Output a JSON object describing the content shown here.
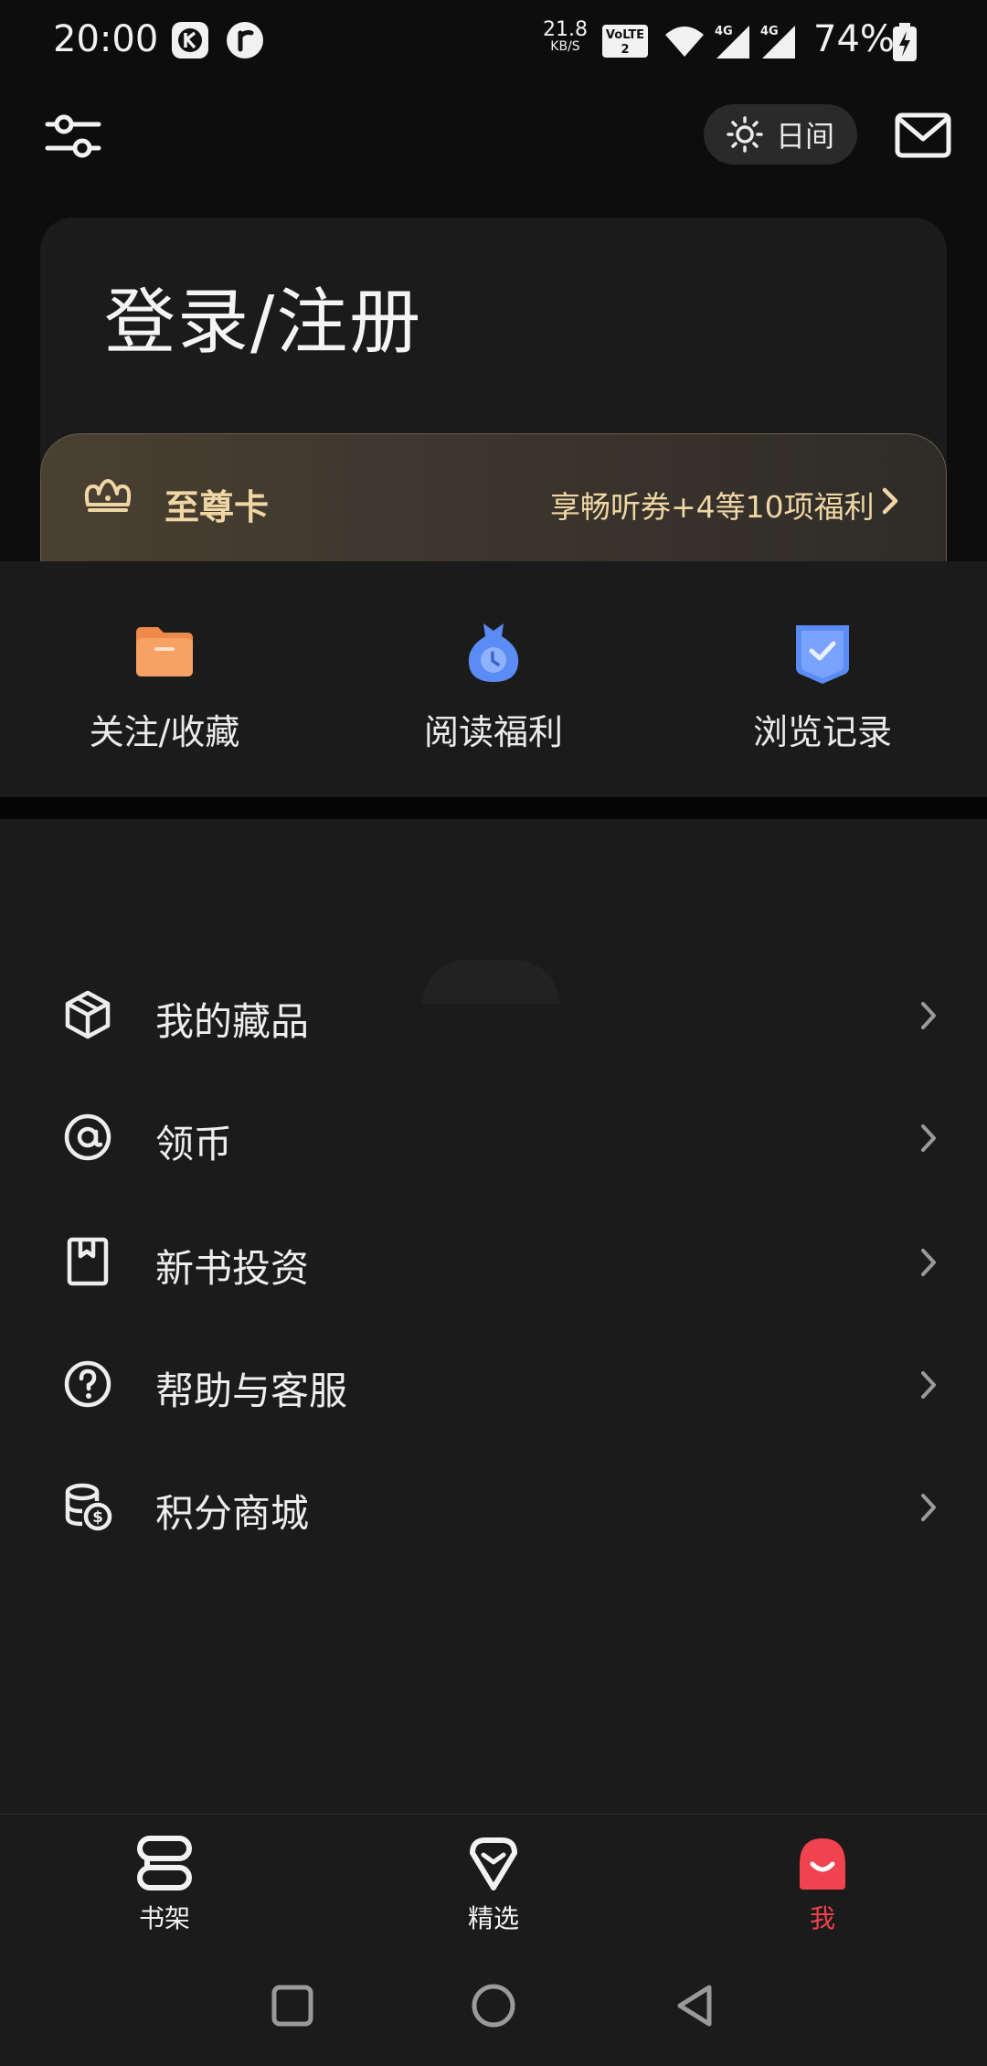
{
  "status_bar": {
    "time": "20:00",
    "speed_value": "21.8",
    "speed_unit": "KB/S",
    "volte_label": "Vo LTE 2",
    "signal_label_1": "4G",
    "signal_label_2": "4G",
    "battery": "74%"
  },
  "header": {
    "daymode_label": "日间",
    "icons": [
      "filter-sliders-icon",
      "sun-icon",
      "mail-icon"
    ]
  },
  "login": {
    "title": "登录/注册"
  },
  "vip": {
    "name": "至尊卡",
    "description": "享畅听券+4等10项福利",
    "accent_color": "#f0d6a4"
  },
  "quick_actions": [
    {
      "label": "关注/收藏",
      "icon": "folder-icon",
      "color": "#f08a4b"
    },
    {
      "label": "阅读福利",
      "icon": "money-bag-icon",
      "color": "#5b8cf5"
    },
    {
      "label": "浏览记录",
      "icon": "shield-check-icon",
      "color": "#5b8cf5"
    }
  ],
  "menu": [
    {
      "label": "我的藏品",
      "icon": "cube-icon"
    },
    {
      "label": "领币",
      "icon": "at-coin-icon"
    },
    {
      "label": "新书投资",
      "icon": "bookmark-book-icon"
    },
    {
      "label": "帮助与客服",
      "icon": "help-circle-icon"
    },
    {
      "label": "积分商城",
      "icon": "coins-stack-icon"
    }
  ],
  "bottom_nav": [
    {
      "label": "书架",
      "icon": "bookshelf-icon",
      "active": false
    },
    {
      "label": "精选",
      "icon": "gem-icon",
      "active": false
    },
    {
      "label": "我",
      "icon": "profile-face-icon",
      "active": true
    }
  ],
  "colors": {
    "active": "#f0424f",
    "background": "#1b1b1b"
  }
}
